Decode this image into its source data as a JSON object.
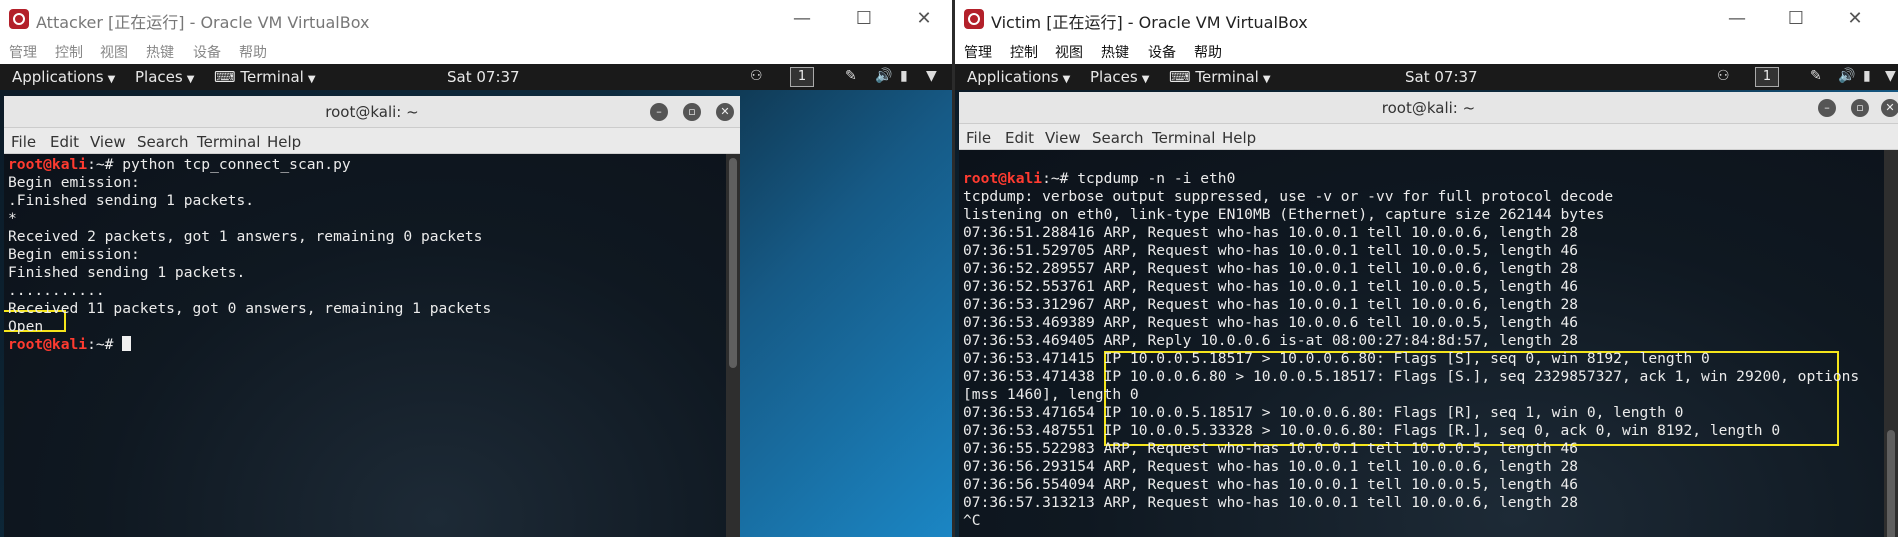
{
  "left_vm": {
    "window_title": "Attacker [正在运行] - Oracle VM VirtualBox",
    "window_controls": {
      "minimize": "—",
      "maximize": "☐",
      "close": "✕"
    },
    "vbox_menu": [
      "管理",
      "控制",
      "视图",
      "热键",
      "设备",
      "帮助"
    ],
    "guest_panel": {
      "applications": "Applications",
      "places": "Places",
      "terminal": "Terminal",
      "clock": "Sat 07:37",
      "workspace": "1"
    },
    "terminal": {
      "title": "root@kali: ~",
      "menu": [
        "File",
        "Edit",
        "View",
        "Search",
        "Terminal",
        "Help"
      ],
      "prompt": "root@kali",
      "prompt_suffix": ":~#",
      "lines": [
        {
          "prompt": true,
          "text": " python tcp_connect_scan.py"
        },
        {
          "prompt": false,
          "text": "Begin emission:"
        },
        {
          "prompt": false,
          "text": ".Finished sending 1 packets."
        },
        {
          "prompt": false,
          "text": "*"
        },
        {
          "prompt": false,
          "text": "Received 2 packets, got 1 answers, remaining 0 packets"
        },
        {
          "prompt": false,
          "text": "Begin emission:"
        },
        {
          "prompt": false,
          "text": "Finished sending 1 packets."
        },
        {
          "prompt": false,
          "text": "..........."
        },
        {
          "prompt": false,
          "text": "Received 11 packets, got 0 answers, remaining 1 packets"
        },
        {
          "prompt": false,
          "text": "Open"
        },
        {
          "prompt": true,
          "text": " ",
          "cursor": true
        }
      ]
    }
  },
  "right_vm": {
    "window_title": "Victim [正在运行] - Oracle VM VirtualBox",
    "window_controls": {
      "minimize": "—",
      "maximize": "☐",
      "close": "✕"
    },
    "vbox_menu": [
      "管理",
      "控制",
      "视图",
      "热键",
      "设备",
      "帮助"
    ],
    "guest_panel": {
      "applications": "Applications",
      "places": "Places",
      "terminal": "Terminal",
      "clock": "Sat 07:37",
      "workspace": "1"
    },
    "terminal": {
      "title": "root@kali: ~",
      "menu": [
        "File",
        "Edit",
        "View",
        "Search",
        "Terminal",
        "Help"
      ],
      "prompt": "root@kali",
      "prompt_suffix": ":~#",
      "lines": [
        {
          "prompt": true,
          "text": " tcpdump -n -i eth0"
        },
        {
          "prompt": false,
          "text": "tcpdump: verbose output suppressed, use -v or -vv for full protocol decode"
        },
        {
          "prompt": false,
          "text": "listening on eth0, link-type EN10MB (Ethernet), capture size 262144 bytes"
        },
        {
          "prompt": false,
          "text": "07:36:51.288416 ARP, Request who-has 10.0.0.1 tell 10.0.0.6, length 28"
        },
        {
          "prompt": false,
          "text": "07:36:51.529705 ARP, Request who-has 10.0.0.1 tell 10.0.0.5, length 46"
        },
        {
          "prompt": false,
          "text": "07:36:52.289557 ARP, Request who-has 10.0.0.1 tell 10.0.0.6, length 28"
        },
        {
          "prompt": false,
          "text": "07:36:52.553761 ARP, Request who-has 10.0.0.1 tell 10.0.0.5, length 46"
        },
        {
          "prompt": false,
          "text": "07:36:53.312967 ARP, Request who-has 10.0.0.1 tell 10.0.0.6, length 28"
        },
        {
          "prompt": false,
          "text": "07:36:53.469389 ARP, Request who-has 10.0.0.6 tell 10.0.0.5, length 46"
        },
        {
          "prompt": false,
          "text": "07:36:53.469405 ARP, Reply 10.0.0.6 is-at 08:00:27:84:8d:57, length 28"
        },
        {
          "prompt": false,
          "text": "07:36:53.471415 IP 10.0.0.5.18517 > 10.0.0.6.80: Flags [S], seq 0, win 8192, length 0"
        },
        {
          "prompt": false,
          "text": "07:36:53.471438 IP 10.0.0.6.80 > 10.0.0.5.18517: Flags [S.], seq 2329857327, ack 1, win 29200, options"
        },
        {
          "prompt": false,
          "text": "[mss 1460], length 0"
        },
        {
          "prompt": false,
          "text": "07:36:53.471654 IP 10.0.0.5.18517 > 10.0.0.6.80: Flags [R], seq 1, win 0, length 0"
        },
        {
          "prompt": false,
          "text": "07:36:53.487551 IP 10.0.0.5.33328 > 10.0.0.6.80: Flags [R.], seq 0, ack 0, win 8192, length 0"
        },
        {
          "prompt": false,
          "text": "07:36:55.522983 ARP, Request who-has 10.0.0.1 tell 10.0.0.5, length 46"
        },
        {
          "prompt": false,
          "text": "07:36:56.293154 ARP, Request who-has 10.0.0.1 tell 10.0.0.6, length 28"
        },
        {
          "prompt": false,
          "text": "07:36:56.554094 ARP, Request who-has 10.0.0.1 tell 10.0.0.5, length 46"
        },
        {
          "prompt": false,
          "text": "07:36:57.313213 ARP, Request who-has 10.0.0.1 tell 10.0.0.6, length 28"
        },
        {
          "prompt": false,
          "text": "^C"
        }
      ]
    }
  },
  "colors": {
    "prompt": "#ff3b30",
    "highlight": "#f5e51b",
    "terminal_bg": "#0e141c"
  },
  "icons": [
    "virtualbox-icon",
    "terminal-icon",
    "network-icon",
    "volume-icon",
    "battery-icon",
    "pen-icon",
    "minimize-icon",
    "maximize-icon",
    "close-icon"
  ]
}
